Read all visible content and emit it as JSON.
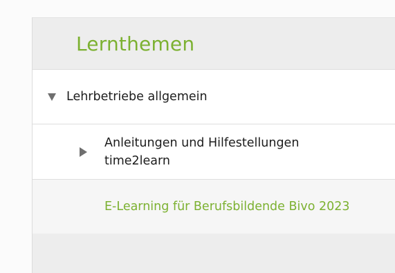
{
  "panel": {
    "title": "Lernthemen"
  },
  "tree": {
    "parent": {
      "label": "Lehrbetriebe allgemein",
      "expanded": true,
      "icon": "triangle-down-icon"
    },
    "children": [
      {
        "label": "Anleitungen und Hilfestellungen time2learn",
        "expanded": false,
        "icon": "triangle-right-icon"
      },
      {
        "label": "E-Learning für Berufsbildende Bivo 2023",
        "selected": true
      }
    ]
  },
  "colors": {
    "accent": "#7cb131",
    "text": "#1c1c1c",
    "panel_bg": "#ededed"
  }
}
